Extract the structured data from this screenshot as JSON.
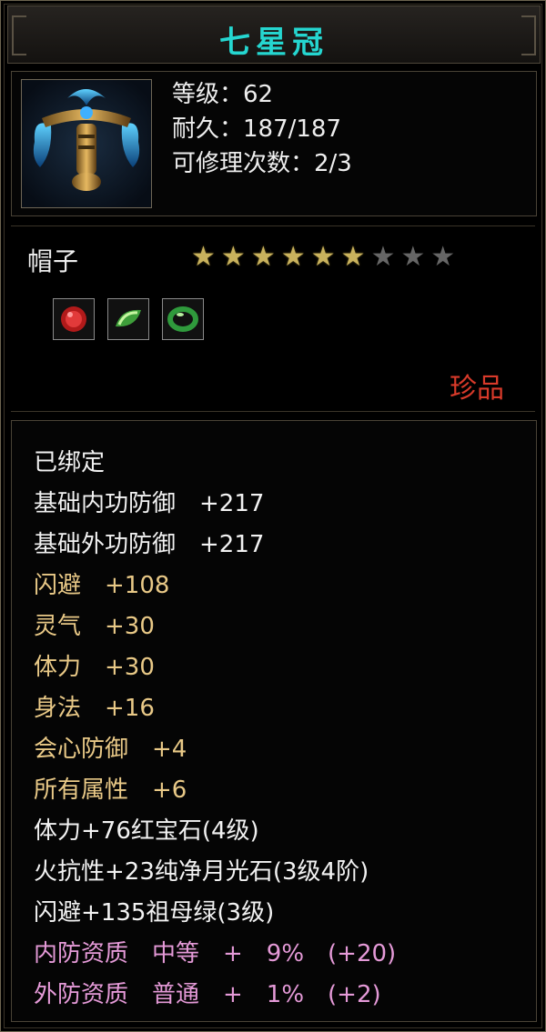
{
  "item": {
    "name": "七星冠",
    "level": "等级：62",
    "durability": "耐久：187/187",
    "repair_count": "可修理次数：2/3",
    "item_icon": "crown-headgear-icon",
    "type": "帽子",
    "stars_total": 9,
    "stars_filled": 6,
    "gem_icons": [
      "ruby-gem-icon",
      "green-gem-icon",
      "emerald-ring-gem-icon"
    ],
    "rarity": "珍品"
  },
  "attributes": [
    {
      "text": "已绑定",
      "color": "white"
    },
    {
      "text": "基础内功防御　+217",
      "color": "white"
    },
    {
      "text": "基础外功防御　+217",
      "color": "white"
    },
    {
      "text": "闪避　+108",
      "color": "gold"
    },
    {
      "text": "灵气　+30",
      "color": "gold"
    },
    {
      "text": "体力　+30",
      "color": "gold"
    },
    {
      "text": "身法　+16",
      "color": "gold"
    },
    {
      "text": "会心防御　+4",
      "color": "gold"
    },
    {
      "text": "所有属性　+6",
      "color": "gold"
    },
    {
      "text": "体力+76红宝石(4级)",
      "color": "white"
    },
    {
      "text": "火抗性+23纯净月光石(3级4阶)",
      "color": "white"
    },
    {
      "text": "闪避+135祖母绿(3级)",
      "color": "white"
    },
    {
      "text": "内防资质　中等　+　9%　(+20)",
      "color": "pink"
    },
    {
      "text": "外防资质　普通　+　1%　(+2)",
      "color": "pink"
    }
  ],
  "colors": {
    "title": "#25d6d0",
    "rarity": "#d83a2a",
    "gold_attr": "#e9c987",
    "pink_attr": "#e59ad8"
  }
}
